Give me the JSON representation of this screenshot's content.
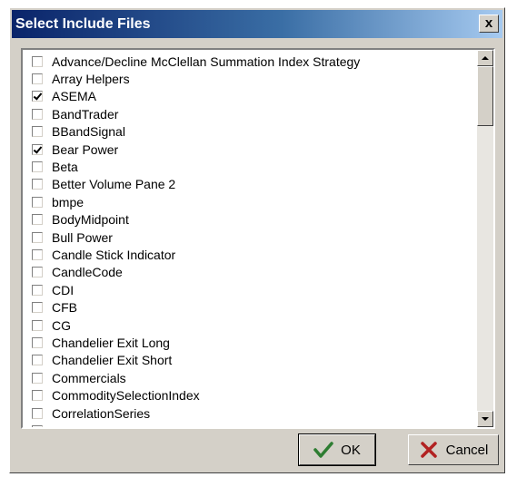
{
  "window": {
    "title": "Select Include Files",
    "close_symbol": "x"
  },
  "list": {
    "items": [
      {
        "label": "Advance/Decline McClellan Summation Index Strategy",
        "checked": false
      },
      {
        "label": "Array Helpers",
        "checked": false
      },
      {
        "label": "ASEMA",
        "checked": true
      },
      {
        "label": "BandTrader",
        "checked": false
      },
      {
        "label": "BBandSignal",
        "checked": false
      },
      {
        "label": "Bear Power",
        "checked": true
      },
      {
        "label": "Beta",
        "checked": false
      },
      {
        "label": "Better Volume Pane 2",
        "checked": false
      },
      {
        "label": "bmpe",
        "checked": false
      },
      {
        "label": "BodyMidpoint",
        "checked": false
      },
      {
        "label": "Bull Power",
        "checked": false
      },
      {
        "label": "Candle Stick Indicator",
        "checked": false
      },
      {
        "label": "CandleCode",
        "checked": false
      },
      {
        "label": "CDI",
        "checked": false
      },
      {
        "label": "CFB",
        "checked": false
      },
      {
        "label": "CG",
        "checked": false
      },
      {
        "label": "Chandelier Exit Long",
        "checked": false
      },
      {
        "label": "Chandelier Exit Short",
        "checked": false
      },
      {
        "label": "Commercials",
        "checked": false
      },
      {
        "label": "CommoditySelectionIndex",
        "checked": false
      },
      {
        "label": "CorrelationSeries",
        "checked": false
      },
      {
        "label": "",
        "checked": false
      }
    ]
  },
  "buttons": {
    "ok_label": "OK",
    "cancel_label": "Cancel"
  },
  "icons": {
    "ok": "checkmark-icon",
    "cancel": "x-icon",
    "scroll_up": "arrow-up-icon",
    "scroll_down": "arrow-down-icon"
  },
  "colors": {
    "title_bar_start": "#0a246a",
    "title_bar_end": "#a6caf0",
    "face": "#d4d0c8",
    "ok_icon": "#2e7d32",
    "cancel_icon": "#b22222"
  }
}
